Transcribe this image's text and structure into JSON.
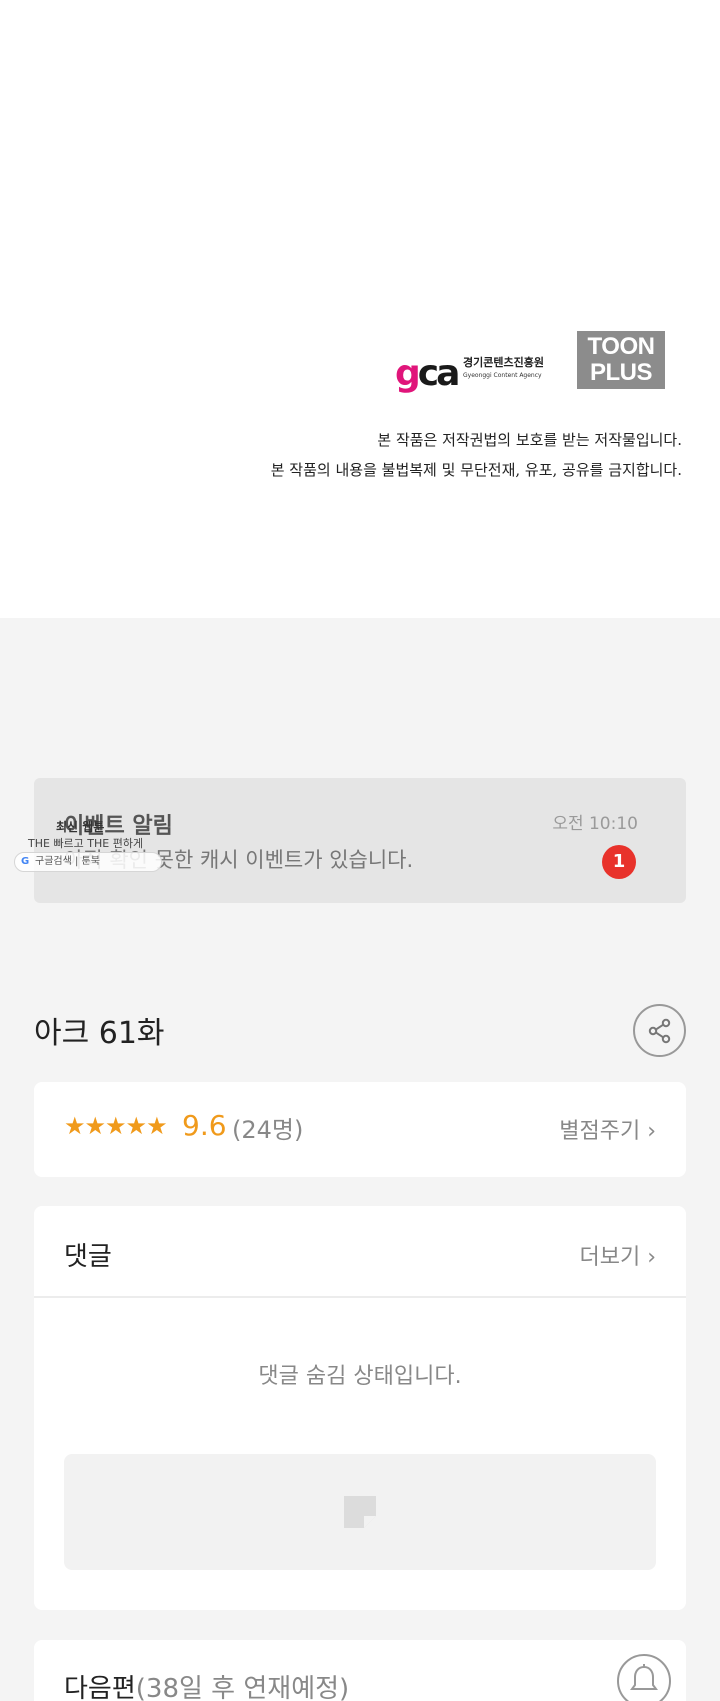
{
  "footer": {
    "gca_org_name": "경기콘텐츠진흥원",
    "gca_org_name_en": "Gyeonggi Content Agency",
    "toonplus_line1": "TOON",
    "toonplus_line2": "PLUS",
    "copyright_line1": "본 작품은 저작권법의 보호를 받는 저작물입니다.",
    "copyright_line2": "본 작품의 내용을 불법복제 및 무단전재, 유포, 공유를 금지합니다."
  },
  "notification": {
    "title": "이벤트 알림",
    "time": "오전 10:10",
    "message": "아직 확인 못한 캐시 이벤트가 있습니다.",
    "badge": "1"
  },
  "overlay": {
    "line1": "최신 웹툰",
    "line2": "THE 빠르고 THE 편하게",
    "search": "구글검색 | 툰북"
  },
  "episode": {
    "title": "아크 61화"
  },
  "rating": {
    "stars": "★★★★★",
    "score": "9.6",
    "count": "(24명)",
    "rate_link": "별점주기 ›"
  },
  "comments": {
    "title": "댓글",
    "more_link": "더보기 ›",
    "hidden_message": "댓글 숨김 상태입니다."
  },
  "next_episode": {
    "label": "다음편",
    "schedule": "(38일 후 연재예정)"
  },
  "colors": {
    "accent_orange": "#f09a1b",
    "badge_red": "#e8322b",
    "gca_pink": "#e0157a"
  }
}
